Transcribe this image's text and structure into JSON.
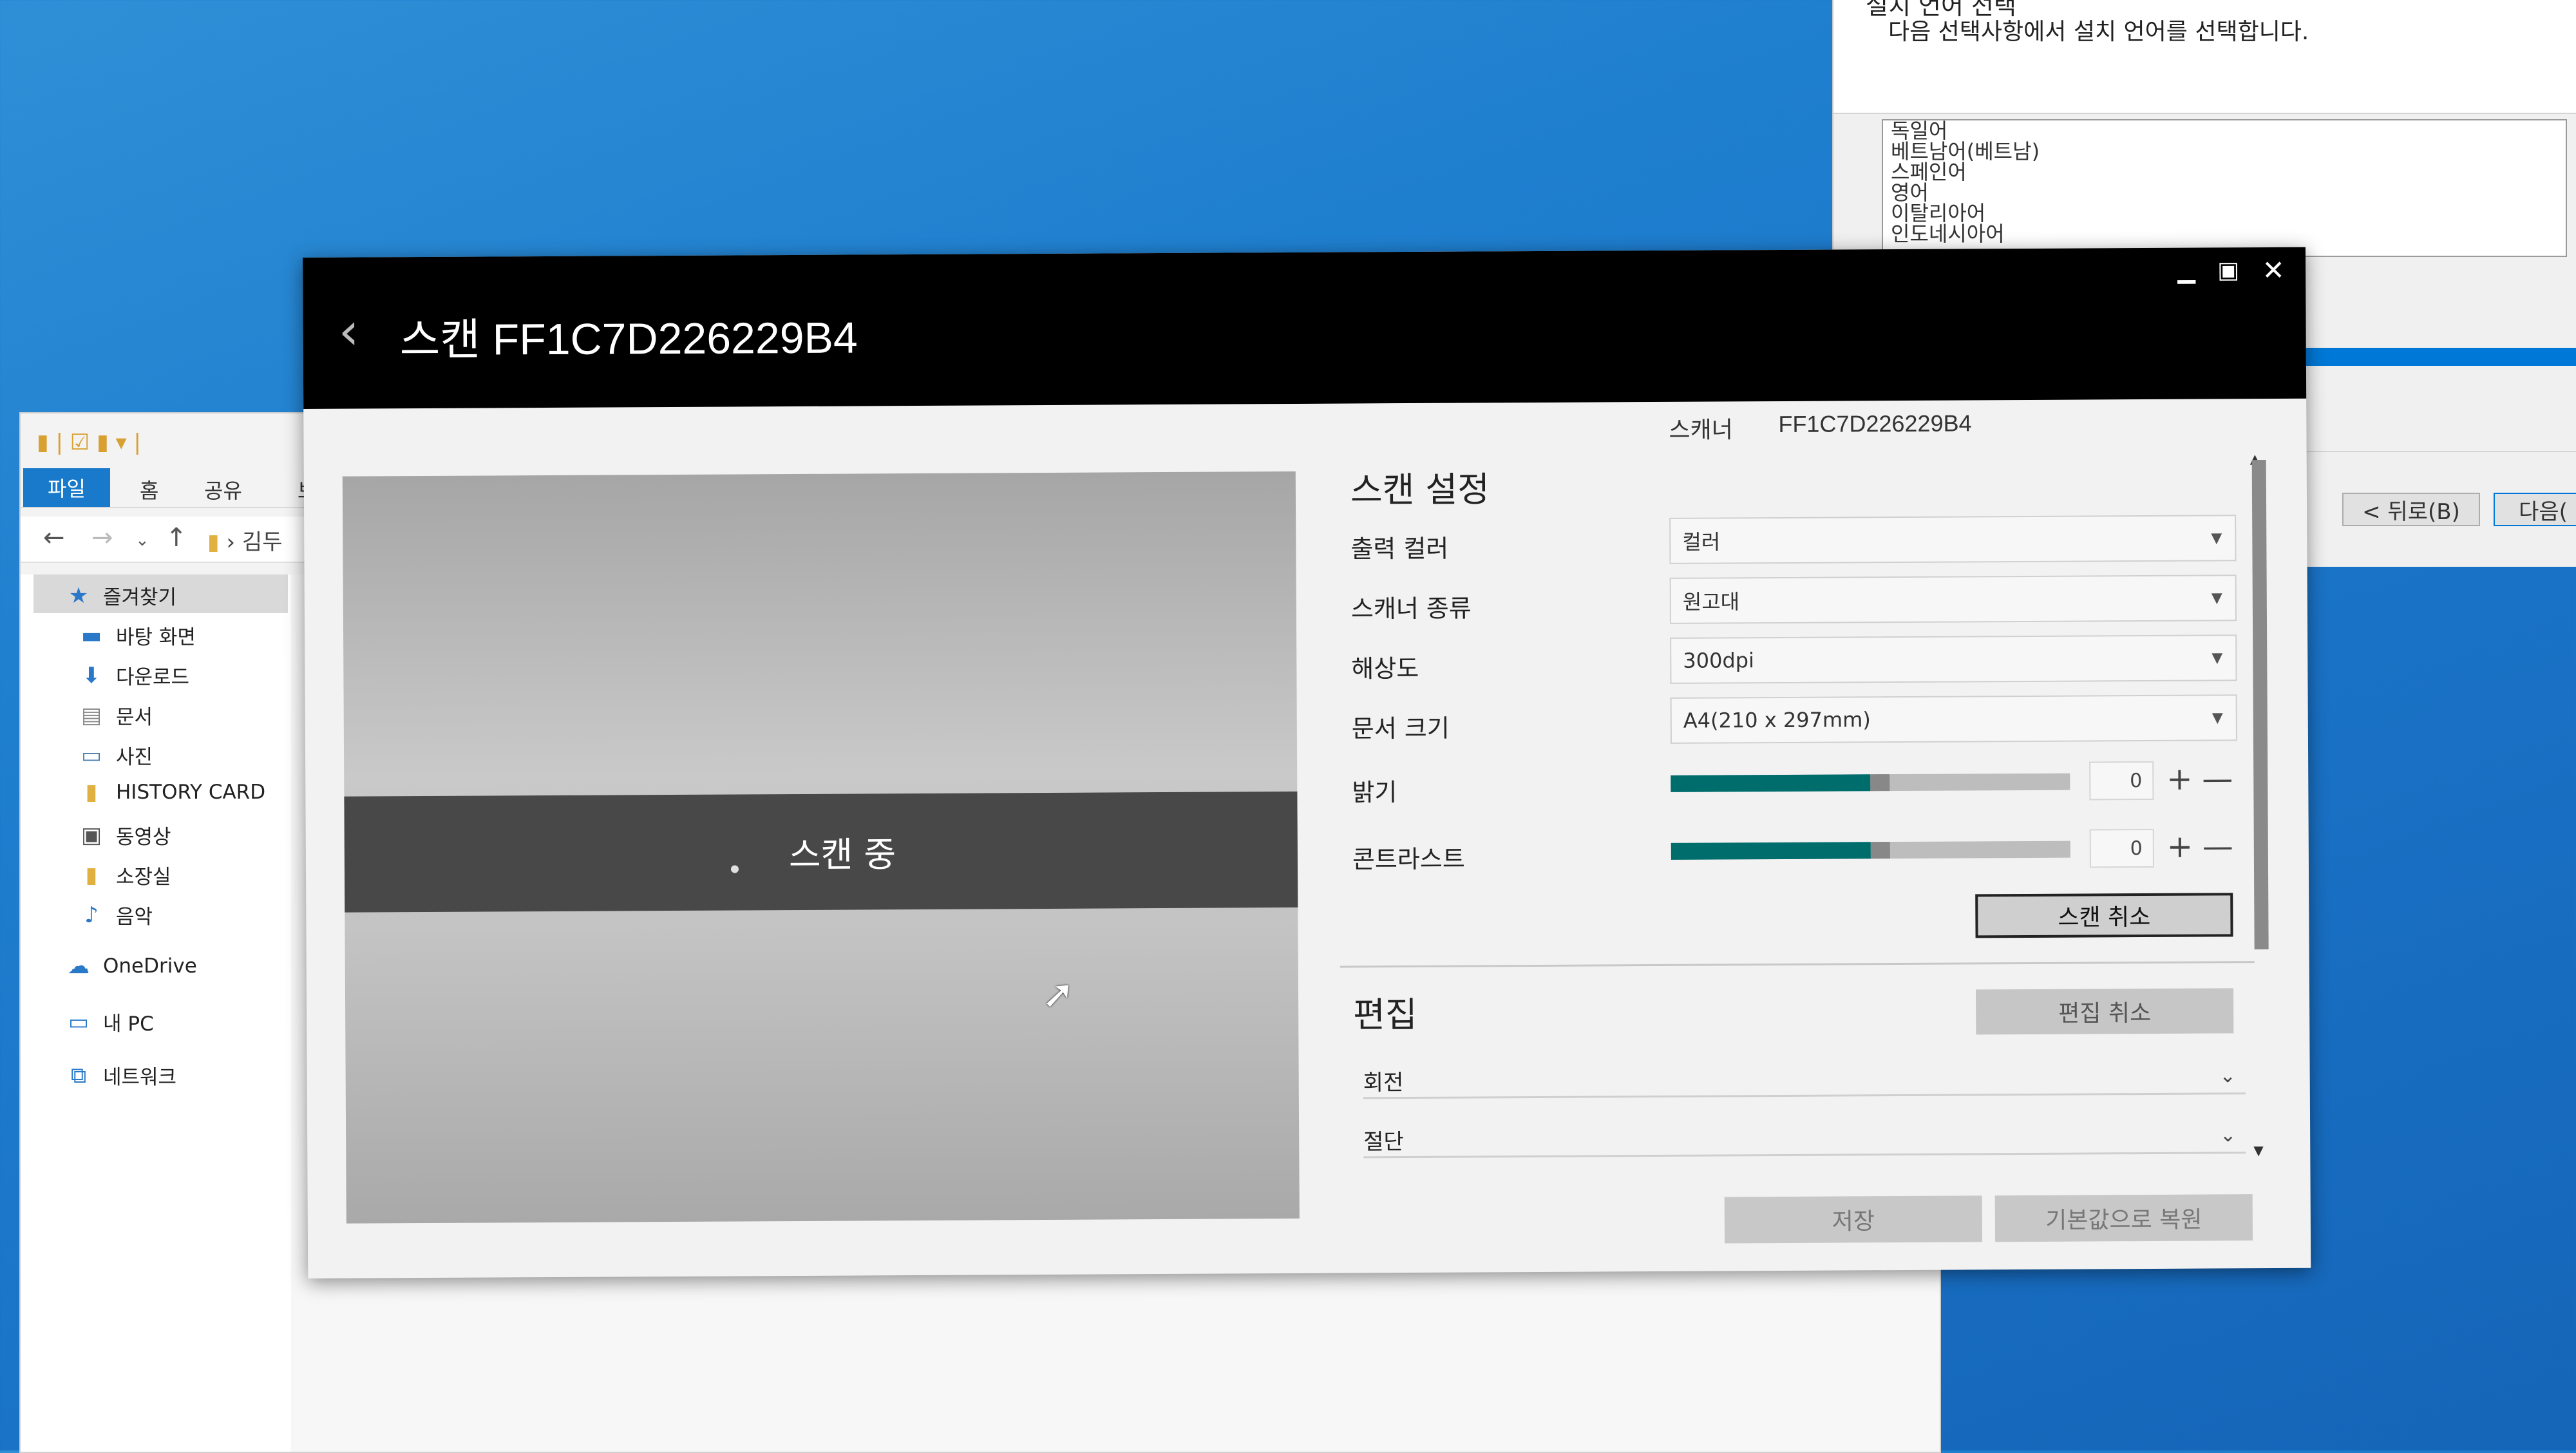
{
  "installer": {
    "title": "설치 언어 선택",
    "subtitle": "다음 선택사항에서 설치 언어를 선택합니다.",
    "languages": [
      "독일어",
      "베트남어(베트남)",
      "스페인어",
      "영어",
      "이탈리아어",
      "인도네시아어"
    ],
    "back_label": "< 뒤로(B)",
    "next_label": "다음("
  },
  "explorer": {
    "tabs": [
      "파일",
      "홈",
      "공유",
      "보"
    ],
    "breadcrumb": "› 김두",
    "nav": {
      "quick_access": "즐겨찾기",
      "items": [
        "바탕 화면",
        "다운로드",
        "문서",
        "사진",
        "HISTORY CARD",
        "동영상",
        "소장실",
        "음악"
      ],
      "onedrive": "OneDrive",
      "this_pc": "내 PC",
      "network": "네트워크"
    }
  },
  "dialog": {
    "title": "스캔 FF1C7D226229B4",
    "scanner_label": "스캐너",
    "scanner_id": "FF1C7D226229B4",
    "preview_status": "스캔 중",
    "scan_settings": {
      "heading": "스캔 설정",
      "output_color": {
        "label": "출력 컬러",
        "value": "컬러"
      },
      "scanner_type": {
        "label": "스캐너 종류",
        "value": "원고대"
      },
      "resolution": {
        "label": "해상도",
        "value": "300dpi"
      },
      "doc_size": {
        "label": "문서 크기",
        "value": "A4(210 x 297mm)"
      },
      "brightness": {
        "label": "밝기",
        "value": "0",
        "level": 0.5
      },
      "contrast": {
        "label": "콘트라스트",
        "value": "0",
        "level": 0.5
      },
      "cancel_scan_label": "스캔 취소"
    },
    "edit": {
      "heading": "편집",
      "cancel_edit_label": "편집 취소",
      "rotate_label": "회전",
      "cut_label": "절단"
    },
    "save_label": "저장",
    "reset_label": "기본값으로 복원"
  }
}
